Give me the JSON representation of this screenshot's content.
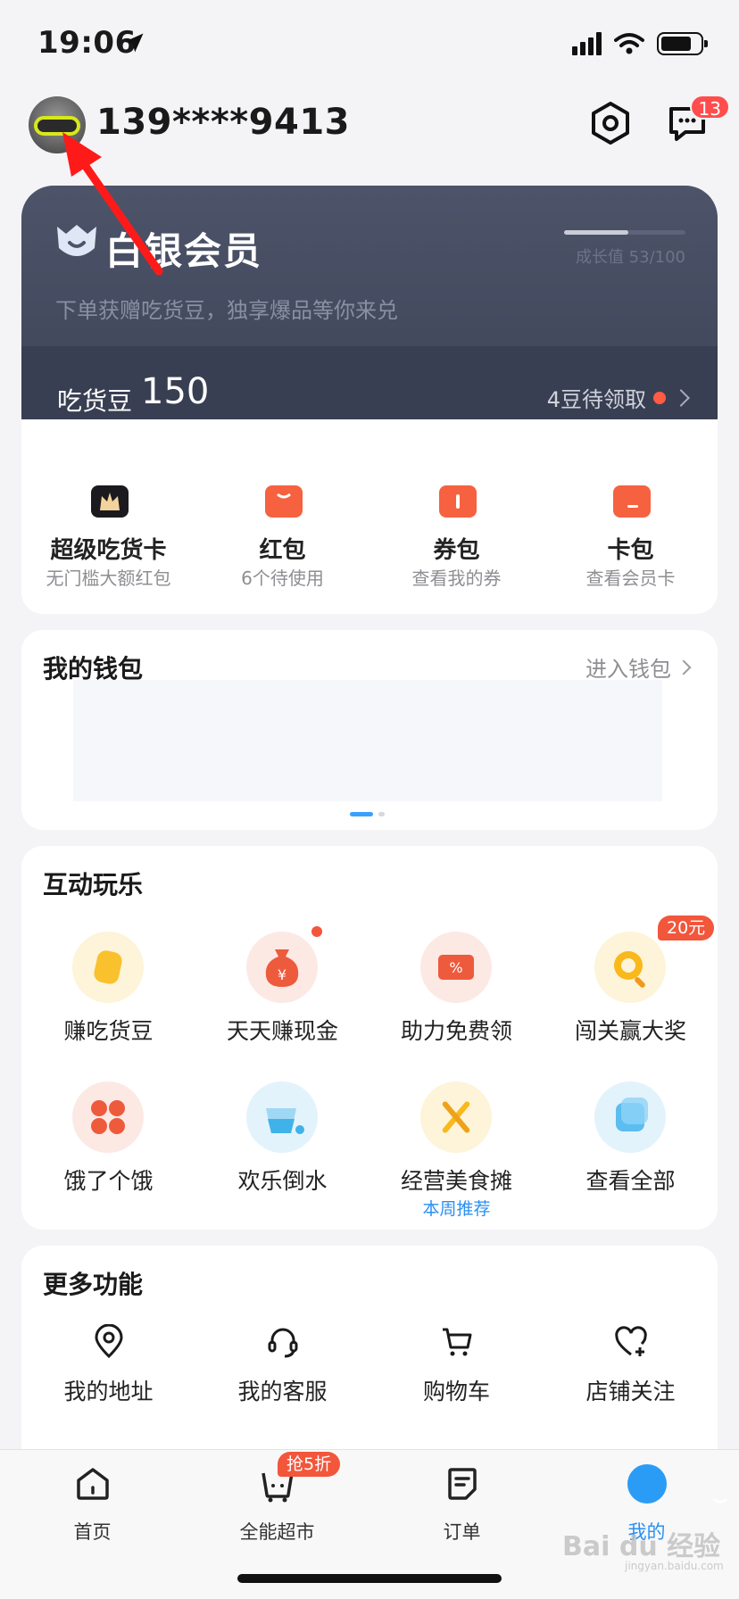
{
  "status_bar": {
    "time": "19:06"
  },
  "header": {
    "phone": "139****9413",
    "message_badge": "13"
  },
  "member": {
    "title": "白银会员",
    "subtitle": "下单获赠吃货豆，独享爆品等你来兑",
    "growth_text": "成长值 53/100",
    "growth_progress": 0.53,
    "beans_label": "吃货豆",
    "beans_value": "150",
    "beans_pending": "4豆待领取"
  },
  "quick": [
    {
      "title": "超级吃货卡",
      "sub": "无门槛大额红包",
      "icon": "vip-card-icon"
    },
    {
      "title": "红包",
      "sub": "6个待使用",
      "icon": "red-packet-icon"
    },
    {
      "title": "券包",
      "sub": "查看我的券",
      "icon": "coupon-icon"
    },
    {
      "title": "卡包",
      "sub": "查看会员卡",
      "icon": "card-wallet-icon"
    }
  ],
  "wallet": {
    "title": "我的钱包",
    "link": "进入钱包"
  },
  "play": {
    "title": "互动玩乐",
    "items": [
      {
        "label": "赚吃货豆",
        "icon": "bean-icon"
      },
      {
        "label": "天天赚现金",
        "icon": "money-bag-icon"
      },
      {
        "label": "助力免费领",
        "icon": "discount-ticket-icon"
      },
      {
        "label": "闯关赢大奖",
        "icon": "magnifier-icon",
        "badge": "20元"
      },
      {
        "label": "饿了个饿",
        "icon": "game-tiles-icon"
      },
      {
        "label": "欢乐倒水",
        "icon": "water-cup-icon"
      },
      {
        "label": "经营美食摊",
        "icon": "food-stall-icon",
        "sub": "本周推荐"
      },
      {
        "label": "查看全部",
        "icon": "cube-icon"
      }
    ]
  },
  "more": {
    "title": "更多功能",
    "items": [
      {
        "label": "我的地址",
        "icon": "location-pin-icon"
      },
      {
        "label": "我的客服",
        "icon": "headset-icon"
      },
      {
        "label": "购物车",
        "icon": "cart-icon"
      },
      {
        "label": "店铺关注",
        "icon": "heart-plus-icon"
      }
    ]
  },
  "tabbar": {
    "tabs": [
      {
        "label": "首页",
        "icon": "home-icon"
      },
      {
        "label": "全能超市",
        "icon": "supermarket-bag-icon",
        "badge": "抢5折"
      },
      {
        "label": "订单",
        "icon": "order-icon"
      },
      {
        "label": "我的",
        "icon": "me-icon",
        "active": true
      }
    ]
  },
  "watermark": {
    "main": "Bai du 经验",
    "sub": "jingyan.baidu.com"
  },
  "colors": {
    "accent": "#2b8ff0",
    "member_bg": "#4d5469",
    "badge_red": "#f2563b"
  }
}
